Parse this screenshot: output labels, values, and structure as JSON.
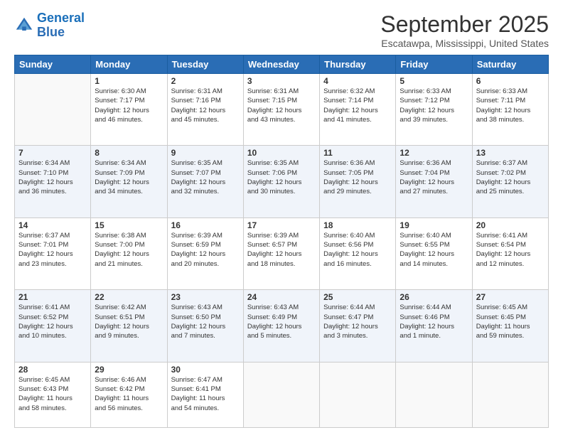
{
  "header": {
    "logo_line1": "General",
    "logo_line2": "Blue",
    "month": "September 2025",
    "location": "Escatawpa, Mississippi, United States"
  },
  "days_of_week": [
    "Sunday",
    "Monday",
    "Tuesday",
    "Wednesday",
    "Thursday",
    "Friday",
    "Saturday"
  ],
  "weeks": [
    [
      {
        "num": "",
        "info": ""
      },
      {
        "num": "1",
        "info": "Sunrise: 6:30 AM\nSunset: 7:17 PM\nDaylight: 12 hours\nand 46 minutes."
      },
      {
        "num": "2",
        "info": "Sunrise: 6:31 AM\nSunset: 7:16 PM\nDaylight: 12 hours\nand 45 minutes."
      },
      {
        "num": "3",
        "info": "Sunrise: 6:31 AM\nSunset: 7:15 PM\nDaylight: 12 hours\nand 43 minutes."
      },
      {
        "num": "4",
        "info": "Sunrise: 6:32 AM\nSunset: 7:14 PM\nDaylight: 12 hours\nand 41 minutes."
      },
      {
        "num": "5",
        "info": "Sunrise: 6:33 AM\nSunset: 7:12 PM\nDaylight: 12 hours\nand 39 minutes."
      },
      {
        "num": "6",
        "info": "Sunrise: 6:33 AM\nSunset: 7:11 PM\nDaylight: 12 hours\nand 38 minutes."
      }
    ],
    [
      {
        "num": "7",
        "info": "Sunrise: 6:34 AM\nSunset: 7:10 PM\nDaylight: 12 hours\nand 36 minutes."
      },
      {
        "num": "8",
        "info": "Sunrise: 6:34 AM\nSunset: 7:09 PM\nDaylight: 12 hours\nand 34 minutes."
      },
      {
        "num": "9",
        "info": "Sunrise: 6:35 AM\nSunset: 7:07 PM\nDaylight: 12 hours\nand 32 minutes."
      },
      {
        "num": "10",
        "info": "Sunrise: 6:35 AM\nSunset: 7:06 PM\nDaylight: 12 hours\nand 30 minutes."
      },
      {
        "num": "11",
        "info": "Sunrise: 6:36 AM\nSunset: 7:05 PM\nDaylight: 12 hours\nand 29 minutes."
      },
      {
        "num": "12",
        "info": "Sunrise: 6:36 AM\nSunset: 7:04 PM\nDaylight: 12 hours\nand 27 minutes."
      },
      {
        "num": "13",
        "info": "Sunrise: 6:37 AM\nSunset: 7:02 PM\nDaylight: 12 hours\nand 25 minutes."
      }
    ],
    [
      {
        "num": "14",
        "info": "Sunrise: 6:37 AM\nSunset: 7:01 PM\nDaylight: 12 hours\nand 23 minutes."
      },
      {
        "num": "15",
        "info": "Sunrise: 6:38 AM\nSunset: 7:00 PM\nDaylight: 12 hours\nand 21 minutes."
      },
      {
        "num": "16",
        "info": "Sunrise: 6:39 AM\nSunset: 6:59 PM\nDaylight: 12 hours\nand 20 minutes."
      },
      {
        "num": "17",
        "info": "Sunrise: 6:39 AM\nSunset: 6:57 PM\nDaylight: 12 hours\nand 18 minutes."
      },
      {
        "num": "18",
        "info": "Sunrise: 6:40 AM\nSunset: 6:56 PM\nDaylight: 12 hours\nand 16 minutes."
      },
      {
        "num": "19",
        "info": "Sunrise: 6:40 AM\nSunset: 6:55 PM\nDaylight: 12 hours\nand 14 minutes."
      },
      {
        "num": "20",
        "info": "Sunrise: 6:41 AM\nSunset: 6:54 PM\nDaylight: 12 hours\nand 12 minutes."
      }
    ],
    [
      {
        "num": "21",
        "info": "Sunrise: 6:41 AM\nSunset: 6:52 PM\nDaylight: 12 hours\nand 10 minutes."
      },
      {
        "num": "22",
        "info": "Sunrise: 6:42 AM\nSunset: 6:51 PM\nDaylight: 12 hours\nand 9 minutes."
      },
      {
        "num": "23",
        "info": "Sunrise: 6:43 AM\nSunset: 6:50 PM\nDaylight: 12 hours\nand 7 minutes."
      },
      {
        "num": "24",
        "info": "Sunrise: 6:43 AM\nSunset: 6:49 PM\nDaylight: 12 hours\nand 5 minutes."
      },
      {
        "num": "25",
        "info": "Sunrise: 6:44 AM\nSunset: 6:47 PM\nDaylight: 12 hours\nand 3 minutes."
      },
      {
        "num": "26",
        "info": "Sunrise: 6:44 AM\nSunset: 6:46 PM\nDaylight: 12 hours\nand 1 minute."
      },
      {
        "num": "27",
        "info": "Sunrise: 6:45 AM\nSunset: 6:45 PM\nDaylight: 11 hours\nand 59 minutes."
      }
    ],
    [
      {
        "num": "28",
        "info": "Sunrise: 6:45 AM\nSunset: 6:43 PM\nDaylight: 11 hours\nand 58 minutes."
      },
      {
        "num": "29",
        "info": "Sunrise: 6:46 AM\nSunset: 6:42 PM\nDaylight: 11 hours\nand 56 minutes."
      },
      {
        "num": "30",
        "info": "Sunrise: 6:47 AM\nSunset: 6:41 PM\nDaylight: 11 hours\nand 54 minutes."
      },
      {
        "num": "",
        "info": ""
      },
      {
        "num": "",
        "info": ""
      },
      {
        "num": "",
        "info": ""
      },
      {
        "num": "",
        "info": ""
      }
    ]
  ]
}
